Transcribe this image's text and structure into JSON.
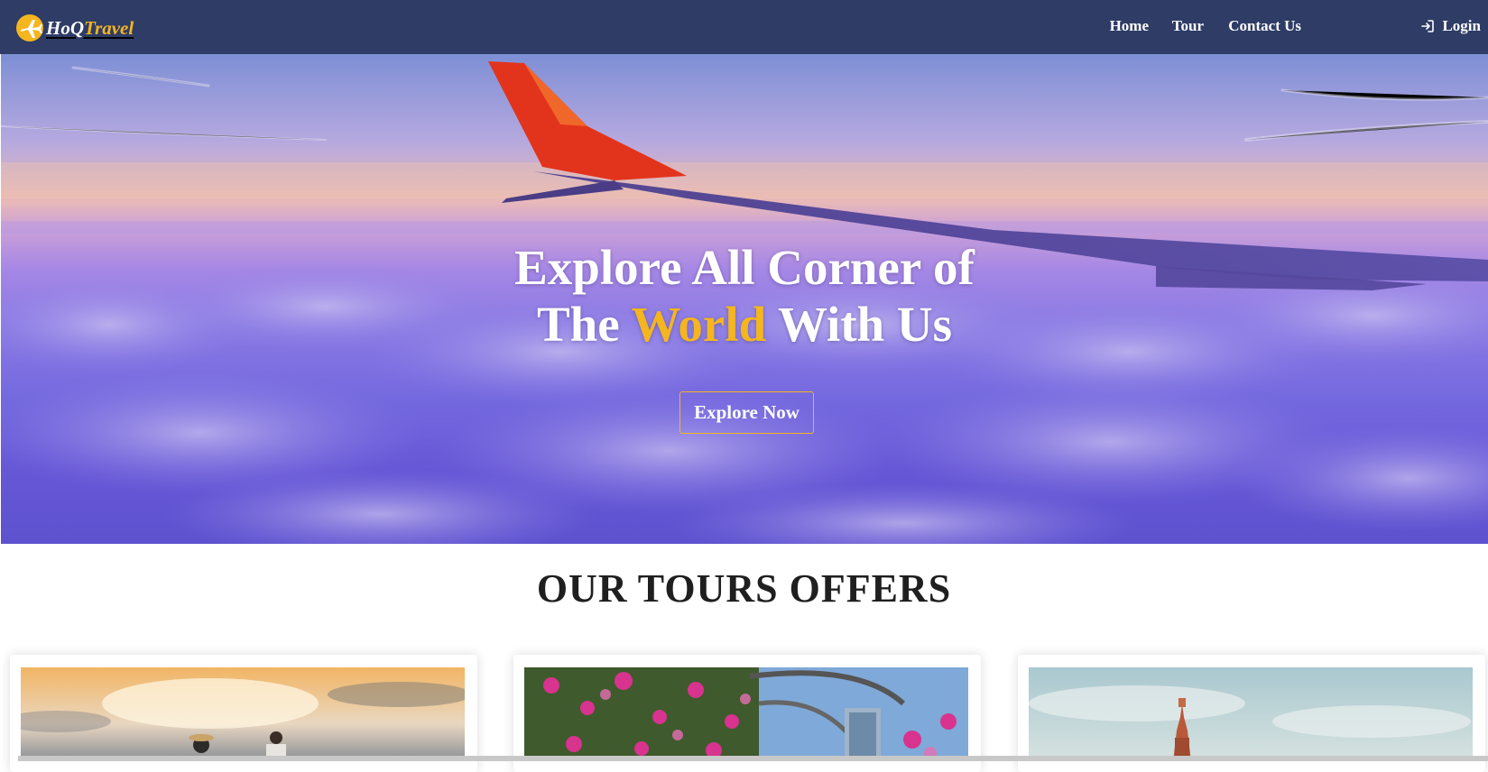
{
  "brand": {
    "name_part1": "HoQ",
    "name_part2": "Travel",
    "icon": "airplane-logo-icon",
    "accent_color": "#f5b51e",
    "nav_color": "#2e3c66"
  },
  "nav": {
    "items": [
      {
        "label": "Home"
      },
      {
        "label": "Tour"
      },
      {
        "label": "Contact Us"
      }
    ],
    "login": {
      "label": "Login",
      "icon": "login-icon"
    }
  },
  "hero": {
    "title_line1": "Explore All Corner of",
    "title_line2_pre": "The ",
    "title_line2_accent": "World",
    "title_line2_post": " With Us",
    "button_label": "Explore Now"
  },
  "tours": {
    "heading": "OUR TOURS OFFERS",
    "cards": [
      {
        "image": "sunset-beach-couple"
      },
      {
        "image": "flowering-garden-city"
      },
      {
        "image": "temple-tower"
      }
    ]
  }
}
